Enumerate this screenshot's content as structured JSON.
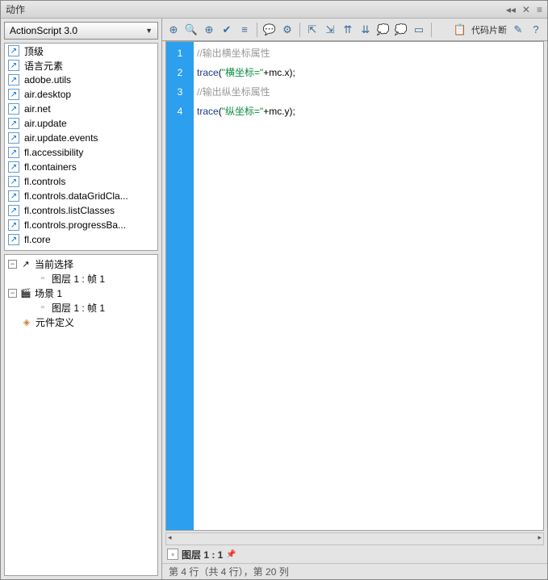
{
  "header": {
    "title": "动作",
    "collapse": "◂◂",
    "close": "✕",
    "menu": "≡"
  },
  "dropdown": {
    "label": "ActionScript 3.0"
  },
  "packages": [
    "顶级",
    "语言元素",
    "adobe.utils",
    "air.desktop",
    "air.net",
    "air.update",
    "air.update.events",
    "fl.accessibility",
    "fl.containers",
    "fl.controls",
    "fl.controls.dataGridCla...",
    "fl.controls.listClasses",
    "fl.controls.progressBa...",
    "fl.core"
  ],
  "tree": {
    "current": "当前选择",
    "layer1a": "图层 1 : 帧 1",
    "scene": "场景 1",
    "layer1b": "图层 1 : 帧 1",
    "symbol": "元件定义"
  },
  "toolbar": {
    "snippet_label": "代码片断"
  },
  "code": {
    "lines": [
      "1",
      "2",
      "3",
      "4"
    ],
    "l1_comment": "//输出横坐标属性",
    "l2_fn": "trace",
    "l2_p1": "(",
    "l2_str": "\"横坐标=\"",
    "l2_rest": "+mc.x);",
    "l3_comment": "//输出纵坐标属性",
    "l4_fn": "trace",
    "l4_p1": "(",
    "l4_str": "\"纵坐标=\"",
    "l4_rest": "+mc.y);"
  },
  "tab": {
    "label": "图层 1 : 1"
  },
  "status": {
    "text": "第 4 行（共 4 行），第 20 列"
  }
}
